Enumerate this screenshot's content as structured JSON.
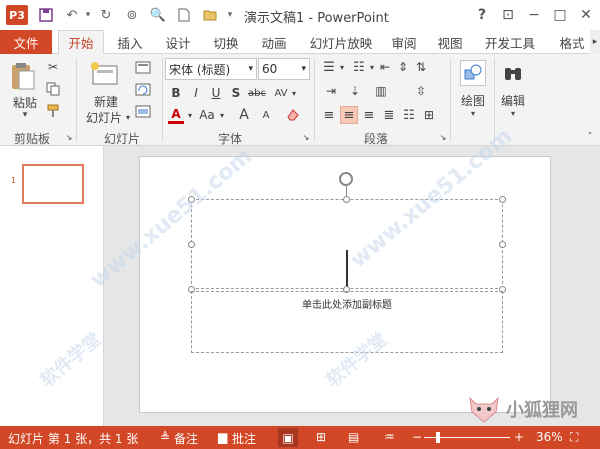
{
  "window": {
    "title": "演示文稿1 - PowerPoint",
    "app_logo": "P3"
  },
  "quick_access": [
    "save-icon",
    "undo-icon",
    "redo-icon",
    "present-icon",
    "print-preview-icon",
    "new-icon",
    "open-icon"
  ],
  "window_buttons": {
    "help": "?",
    "restore_ribbon": "⊡",
    "minimize": "−",
    "maximize": "□",
    "close": "✕"
  },
  "tabs": [
    {
      "label": "文件"
    },
    {
      "label": "开始"
    },
    {
      "label": "插入"
    },
    {
      "label": "设计"
    },
    {
      "label": "切换"
    },
    {
      "label": "动画"
    },
    {
      "label": "幻灯片放映"
    },
    {
      "label": "审阅"
    },
    {
      "label": "视图"
    },
    {
      "label": "开发工具"
    },
    {
      "label": "格式"
    }
  ],
  "ribbon": {
    "clipboard": {
      "label": "剪贴板",
      "paste": "粘贴"
    },
    "slides": {
      "label": "幻灯片",
      "new_slide_1": "新建",
      "new_slide_2": "幻灯片"
    },
    "font": {
      "label": "字体",
      "font_name": "宋体 (标题)",
      "font_size": "60",
      "bold": "B",
      "italic": "I",
      "underline": "U",
      "shadow": "S",
      "strike": "abc",
      "spacing": "AV",
      "font_color": "A",
      "change_case": "Aa",
      "grow": "A",
      "shrink": "A"
    },
    "paragraph": {
      "label": "段落"
    },
    "drawing": {
      "label": "绘图"
    },
    "editing": {
      "label": "编辑"
    }
  },
  "slide": {
    "subtitle_placeholder": "单击此处添加副标题"
  },
  "watermarks": [
    "www.xue51.com",
    "软件学堂",
    "小狐狸网"
  ],
  "status": {
    "slide_info": "幻灯片 第 1 张，共 1 张",
    "notes": "备注",
    "comments": "批注",
    "zoom": "36%"
  },
  "colors": {
    "accent": "#d24726",
    "ribbon_bg": "#f3f3f3"
  }
}
